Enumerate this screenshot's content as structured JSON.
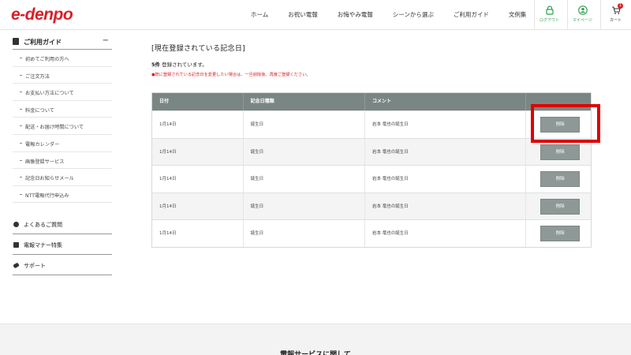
{
  "header": {
    "logo": "e-denpo",
    "nav": [
      "ホーム",
      "お祝い電報",
      "お悔やみ電報",
      "シーンから選ぶ",
      "ご利用ガイド",
      "文例集"
    ],
    "logout_label": "ログアウト",
    "mypage_label": "マイページ",
    "cart_label": "カート",
    "cart_count": "1",
    "accent_color": "#d8202a",
    "green_color": "#2ba14a"
  },
  "sidebar": {
    "title": "ご利用ガイド",
    "toggle": "−",
    "items": [
      "初めてご利用の方へ",
      "ご注文方法",
      "お支払い方法について",
      "料金について",
      "配送・お届け時間について",
      "電報カレンダー",
      "画像登録サービス",
      "記念日お知らせメール",
      "NTT電報代行申込み"
    ],
    "groups": [
      "よくあるご質問",
      "電報マナー特集",
      "サポート"
    ]
  },
  "main": {
    "title": "[現在登録されている記念日]",
    "count_num": "5件",
    "count_text": " 登録されています。",
    "notice": "●既に登録されている記念日を変更したい場合は、一旦削除後、再度ご登録ください。",
    "columns": [
      "日付",
      "記念日種類",
      "コメント",
      ""
    ],
    "rows": [
      {
        "date": "1月14日",
        "type": "誕生日",
        "comment": "岩本 竜也の誕生日",
        "action": "削除"
      },
      {
        "date": "1月14日",
        "type": "誕生日",
        "comment": "岩本 竜也の誕生日",
        "action": "削除"
      },
      {
        "date": "1月14日",
        "type": "誕生日",
        "comment": "岩本 竜也の誕生日",
        "action": "削除"
      },
      {
        "date": "1月14日",
        "type": "誕生日",
        "comment": "岩本 竜也の誕生日",
        "action": "削除"
      },
      {
        "date": "1月14日",
        "type": "誕生日",
        "comment": "岩本 竜也の誕生日",
        "action": "削除"
      }
    ]
  },
  "footer": {
    "title": "電報サービスに関して"
  }
}
